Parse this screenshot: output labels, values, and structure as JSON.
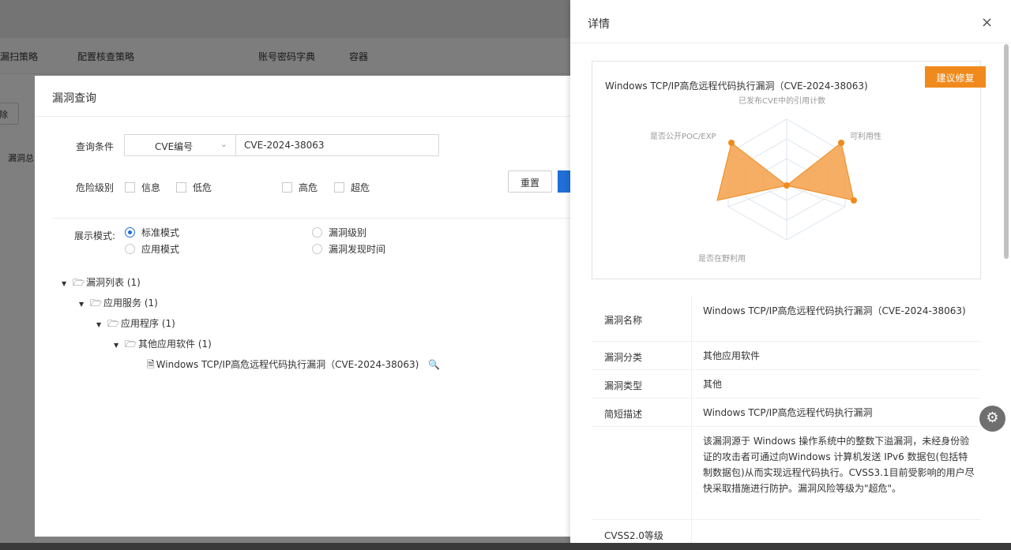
{
  "background": {
    "tabs": [
      "漏扫策略",
      "配置核查策略",
      "账号密码字典",
      "容器"
    ],
    "left_button": "除",
    "left_label": "漏洞总"
  },
  "query_modal": {
    "title": "漏洞查询",
    "condition_label": "查询条件",
    "select_value": "CVE编号",
    "input_value": "CVE-2024-38063",
    "risk_label": "危险级别",
    "risk_levels": [
      "信息",
      "低危",
      "高危",
      "超危"
    ],
    "reset_label": "重置",
    "display_label": "展示模式:",
    "display_options": [
      "标准模式",
      "漏洞级别",
      "应用模式",
      "漏洞发现时间"
    ],
    "tree": [
      {
        "label": "漏洞列表 (1)",
        "level": 0
      },
      {
        "label": "应用服务 (1)",
        "level": 1
      },
      {
        "label": "应用程序 (1)",
        "level": 2
      },
      {
        "label": "其他应用软件 (1)",
        "level": 3
      },
      {
        "label": "Windows TCP/IP高危远程代码执行漏洞（CVE-2024-38063)",
        "level": 4
      }
    ]
  },
  "drawer": {
    "title": "详情",
    "close": "×",
    "suggest_button": "建议修复",
    "card_title": "Windows TCP/IP高危远程代码执行漏洞（CVE-2024-38063)",
    "radar_labels": {
      "top": "已发布CVE中的引用计数",
      "right": "可利用性",
      "left": "是否公开POC/EXP",
      "bottom": "是否在野利用"
    },
    "rows": [
      {
        "key": "漏洞名称",
        "value": "Windows TCP/IP高危远程代码执行漏洞（CVE-2024-38063)"
      },
      {
        "key": "漏洞分类",
        "value": "其他应用软件"
      },
      {
        "key": "漏洞类型",
        "value": "其他"
      },
      {
        "key": "简短描述",
        "value": "Windows TCP/IP高危远程代码执行漏洞"
      },
      {
        "key": "",
        "value": "该漏洞源于 Windows 操作系统中的整数下溢漏洞，未经身份验证的攻击者可通过向Windows 计算机发送 IPv6 数据包(包括特制数据包)从而实现远程代码执行。CVSS3.1目前受影响的用户尽快采取措施进行防护。漏洞风险等级为\"超危\"。"
      },
      {
        "key": "CVSS2.0等级",
        "value": ""
      }
    ]
  },
  "colors": {
    "accent": "#1f6fd6",
    "radar_fill": "#f5a04a",
    "suggest_bg": "#f08a1c"
  }
}
